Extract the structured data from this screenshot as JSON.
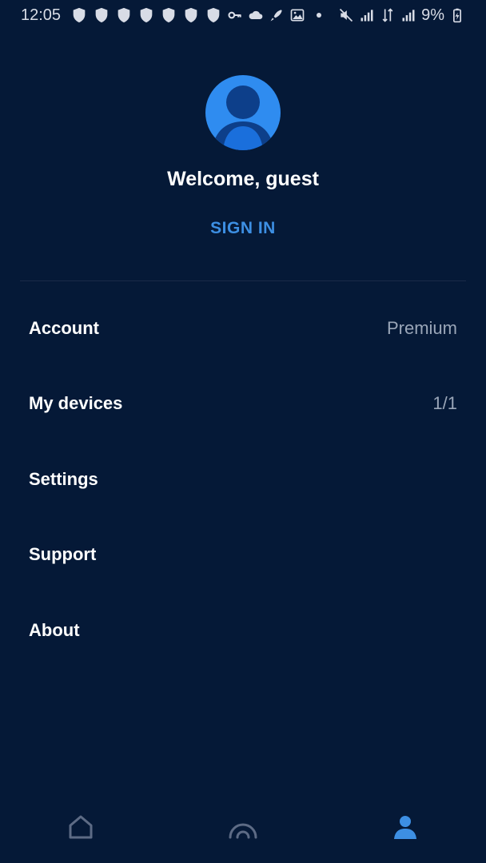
{
  "status_bar": {
    "time": "12:05",
    "battery": "9%",
    "shield_count": 7
  },
  "profile": {
    "welcome": "Welcome, guest",
    "sign_in_label": "SIGN IN"
  },
  "menu": {
    "items": [
      {
        "label": "Account",
        "value": "Premium"
      },
      {
        "label": "My devices",
        "value": "1/1"
      },
      {
        "label": "Settings",
        "value": ""
      },
      {
        "label": "Support",
        "value": ""
      },
      {
        "label": "About",
        "value": ""
      }
    ]
  },
  "bottom_nav": {
    "items": [
      {
        "icon": "home-icon",
        "active": false
      },
      {
        "icon": "vpn-signal-icon",
        "active": false
      },
      {
        "icon": "profile-icon",
        "active": true
      }
    ]
  },
  "colors": {
    "background": "#051937",
    "accent": "#3d8fe3",
    "inactive_icon": "#5d6b85",
    "secondary_text": "#9aa6b8"
  }
}
